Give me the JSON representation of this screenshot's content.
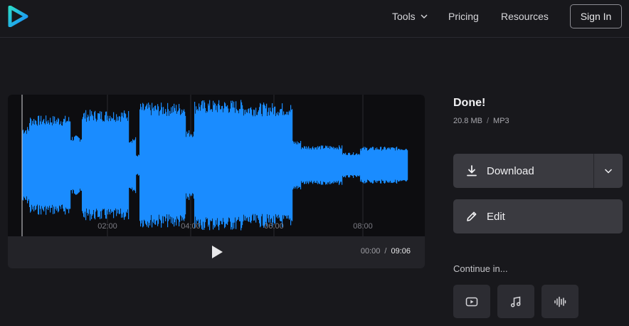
{
  "header": {
    "nav": {
      "tools": "Tools",
      "pricing": "Pricing",
      "resources": "Resources"
    },
    "sign_in": "Sign In"
  },
  "player": {
    "timeline_ticks": [
      "02:00",
      "04:00",
      "06:00",
      "08:00"
    ],
    "current_time": "00:00",
    "total_time": "09:06",
    "time_separator": "/",
    "waveform_color": "#1a8cff"
  },
  "result": {
    "title": "Done!",
    "file_size": "20.8 MB",
    "format": "MP3",
    "separator": "/",
    "download_label": "Download",
    "edit_label": "Edit"
  },
  "continue": {
    "label": "Continue in...",
    "tools": [
      "video-icon",
      "music-note-icon",
      "audio-wave-icon"
    ]
  },
  "colors": {
    "background": "#18181c",
    "button": "#3a3a40",
    "accent_logo": "#19c3d9"
  }
}
